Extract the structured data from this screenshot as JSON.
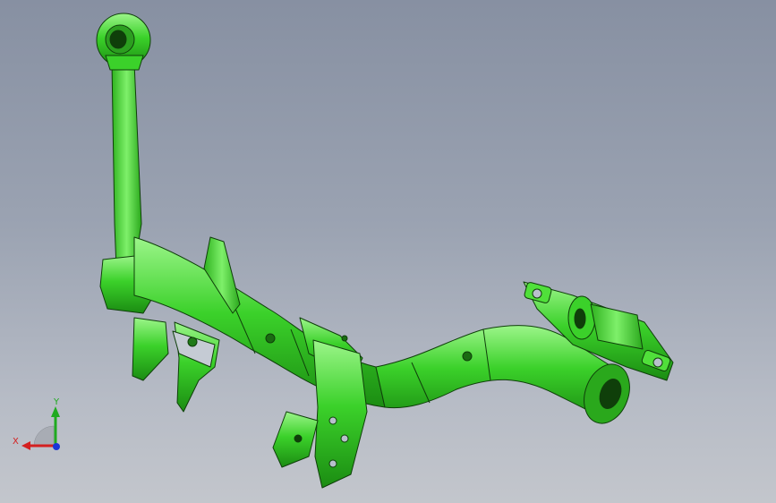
{
  "viewport": {
    "background_top": "#8790a2",
    "background_bottom": "#c3c6cc",
    "model_color": "#38d02c",
    "model_edge_color": "#0f3f0a"
  },
  "triad": {
    "x_label": "X",
    "y_label": "Y",
    "x_color": "#d42020",
    "y_color": "#1faa1f",
    "z_color": "#1a35d8"
  }
}
